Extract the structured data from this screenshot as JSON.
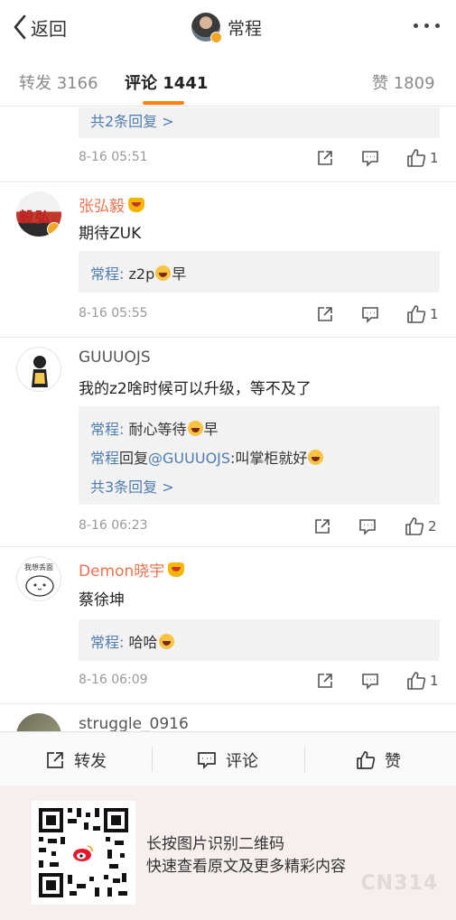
{
  "header": {
    "back_label": "返回",
    "title": "常程"
  },
  "tabs": [
    {
      "label": "转发 3166"
    },
    {
      "label": "评论 1441",
      "active": true
    },
    {
      "label": "赞 1809"
    }
  ],
  "comments": [
    {
      "replies": [
        {
          "link": "共2条回复 >"
        }
      ],
      "time": "8-16 05:51",
      "likes": "1"
    },
    {
      "name": "张弘毅",
      "avatar_text": "毅弘",
      "text": "期待ZUK",
      "replies": [
        {
          "author": "常程",
          "text": "z2p",
          "suffix": "早"
        }
      ],
      "time": "8-16 05:55",
      "likes": "1"
    },
    {
      "name": "GUUUOJS",
      "text": "我的z2啥时候可以升级，等不及了",
      "replies": [
        {
          "author": "常程",
          "text": "耐心等待",
          "suffix": "早"
        },
        {
          "author": "常程",
          "mid": "回复",
          "mention": "@GUUUOJS",
          "text": ":叫掌柜就好"
        },
        {
          "link": "共3条回复 >"
        }
      ],
      "time": "8-16 06:23",
      "likes": "2"
    },
    {
      "name": "Demon晓宇",
      "avatar_text": "我想丢面",
      "text": "蔡徐坤",
      "replies": [
        {
          "author": "常程",
          "text": "哈哈"
        }
      ],
      "time": "8-16 06:09",
      "likes": "1"
    },
    {
      "name": "struggle_0916"
    }
  ],
  "bottombar": {
    "repost": "转发",
    "comment": "评论",
    "like": "赞"
  },
  "promo": {
    "line1": "长按图片识别二维码",
    "line2": "快速查看原文及更多精彩内容",
    "watermark": "CN314"
  },
  "colors": {
    "accent": "#ff8200",
    "link": "#507daf",
    "vip_name": "#eb7350"
  }
}
